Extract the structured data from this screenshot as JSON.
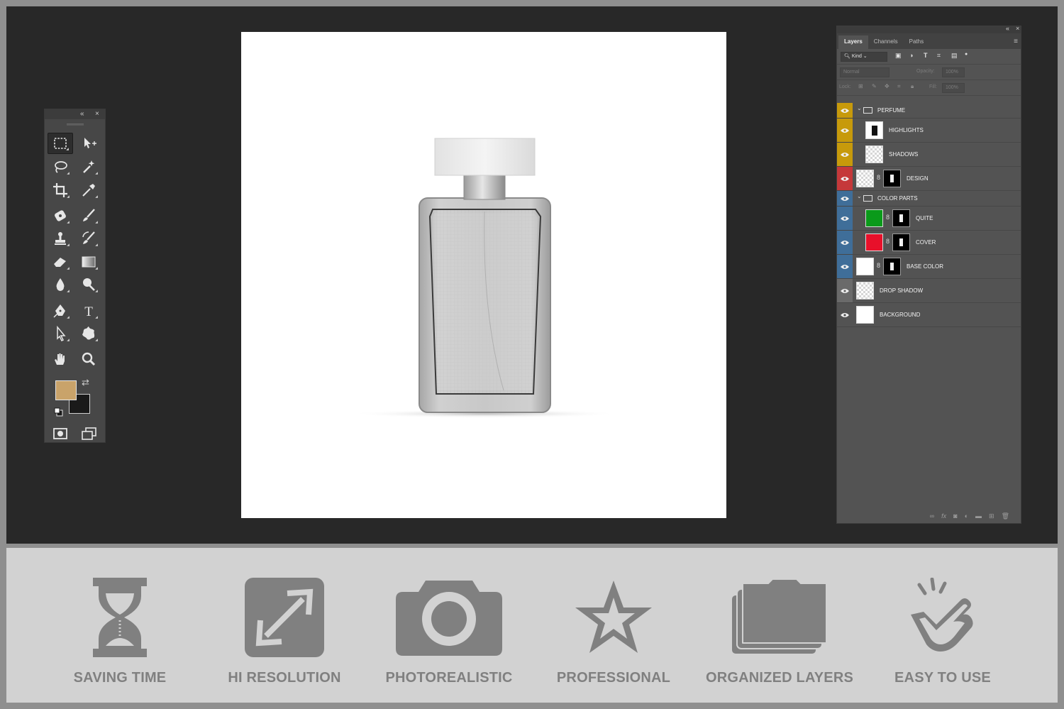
{
  "tools_panel": {
    "collapse_label": "«",
    "close_label": "×",
    "foreground_color": "#c9a36a",
    "background_color": "#1a1a1a",
    "tools": [
      {
        "icon": "rectangular-marquee-icon"
      },
      {
        "icon": "move-icon"
      },
      {
        "icon": "lasso-icon"
      },
      {
        "icon": "magic-wand-icon"
      },
      {
        "icon": "crop-icon"
      },
      {
        "icon": "eyedropper-icon"
      },
      {
        "icon": "healing-brush-icon"
      },
      {
        "icon": "brush-icon"
      },
      {
        "icon": "clone-stamp-icon"
      },
      {
        "icon": "history-brush-icon"
      },
      {
        "icon": "eraser-icon"
      },
      {
        "icon": "gradient-icon"
      },
      {
        "icon": "blur-icon"
      },
      {
        "icon": "dodge-icon"
      },
      {
        "icon": "pen-icon"
      },
      {
        "icon": "type-icon"
      },
      {
        "icon": "path-selection-icon"
      },
      {
        "icon": "custom-shape-icon"
      },
      {
        "icon": "hand-icon"
      },
      {
        "icon": "zoom-icon"
      },
      {
        "icon": "quick-mask-icon"
      },
      {
        "icon": "screen-mode-icon"
      }
    ]
  },
  "layers_panel": {
    "tabs": [
      "Layers",
      "Channels",
      "Paths"
    ],
    "kind_label": "Kind",
    "blend_mode": "Normal",
    "opacity_label": "Opacity:",
    "opacity_value": "100%",
    "lock_label": "Lock:",
    "fill_label": "Fill:",
    "fill_value": "100%",
    "layers": [
      {
        "name": "PERFUME",
        "type": "group",
        "color": "#c79a0b"
      },
      {
        "name": "HIGHLIGHTS",
        "type": "layer",
        "color": "#c79a0b"
      },
      {
        "name": "SHADOWS",
        "type": "layer",
        "color": "#c79a0b"
      },
      {
        "name": "DESIGN",
        "type": "smart",
        "color": "#c5383a"
      },
      {
        "name": "COLOR PARTS",
        "type": "group",
        "color": "#3f6e99"
      },
      {
        "name": "QUITE",
        "type": "fill",
        "color": "#3f6e99",
        "swatch": "#0a9a1a"
      },
      {
        "name": "COVER",
        "type": "fill",
        "color": "#3f6e99",
        "swatch": "#e8102a"
      },
      {
        "name": "BASE COLOR",
        "type": "fill",
        "color": "#3f6e99",
        "swatch": "#ffffff"
      },
      {
        "name": "DROP SHADOW",
        "type": "layer",
        "color": "#6a6a6a"
      },
      {
        "name": "BACKGROUND",
        "type": "layer",
        "color": "#535353"
      }
    ],
    "bottom_icons": [
      "link-icon",
      "fx-icon",
      "mask-icon",
      "adjustment-icon",
      "new-group-icon",
      "new-layer-icon",
      "trash-icon"
    ]
  },
  "features": [
    {
      "label": "SAVING TIME",
      "icon": "hourglass-icon"
    },
    {
      "label": "HI RESOLUTION",
      "icon": "expand-arrows-icon"
    },
    {
      "label": "PHOTOREALISTIC",
      "icon": "camera-icon"
    },
    {
      "label": "PROFESSIONAL",
      "icon": "star-icon"
    },
    {
      "label": "ORGANIZED LAYERS",
      "icon": "stacked-folders-icon"
    },
    {
      "label": "EASY TO USE",
      "icon": "tap-hand-icon"
    }
  ]
}
